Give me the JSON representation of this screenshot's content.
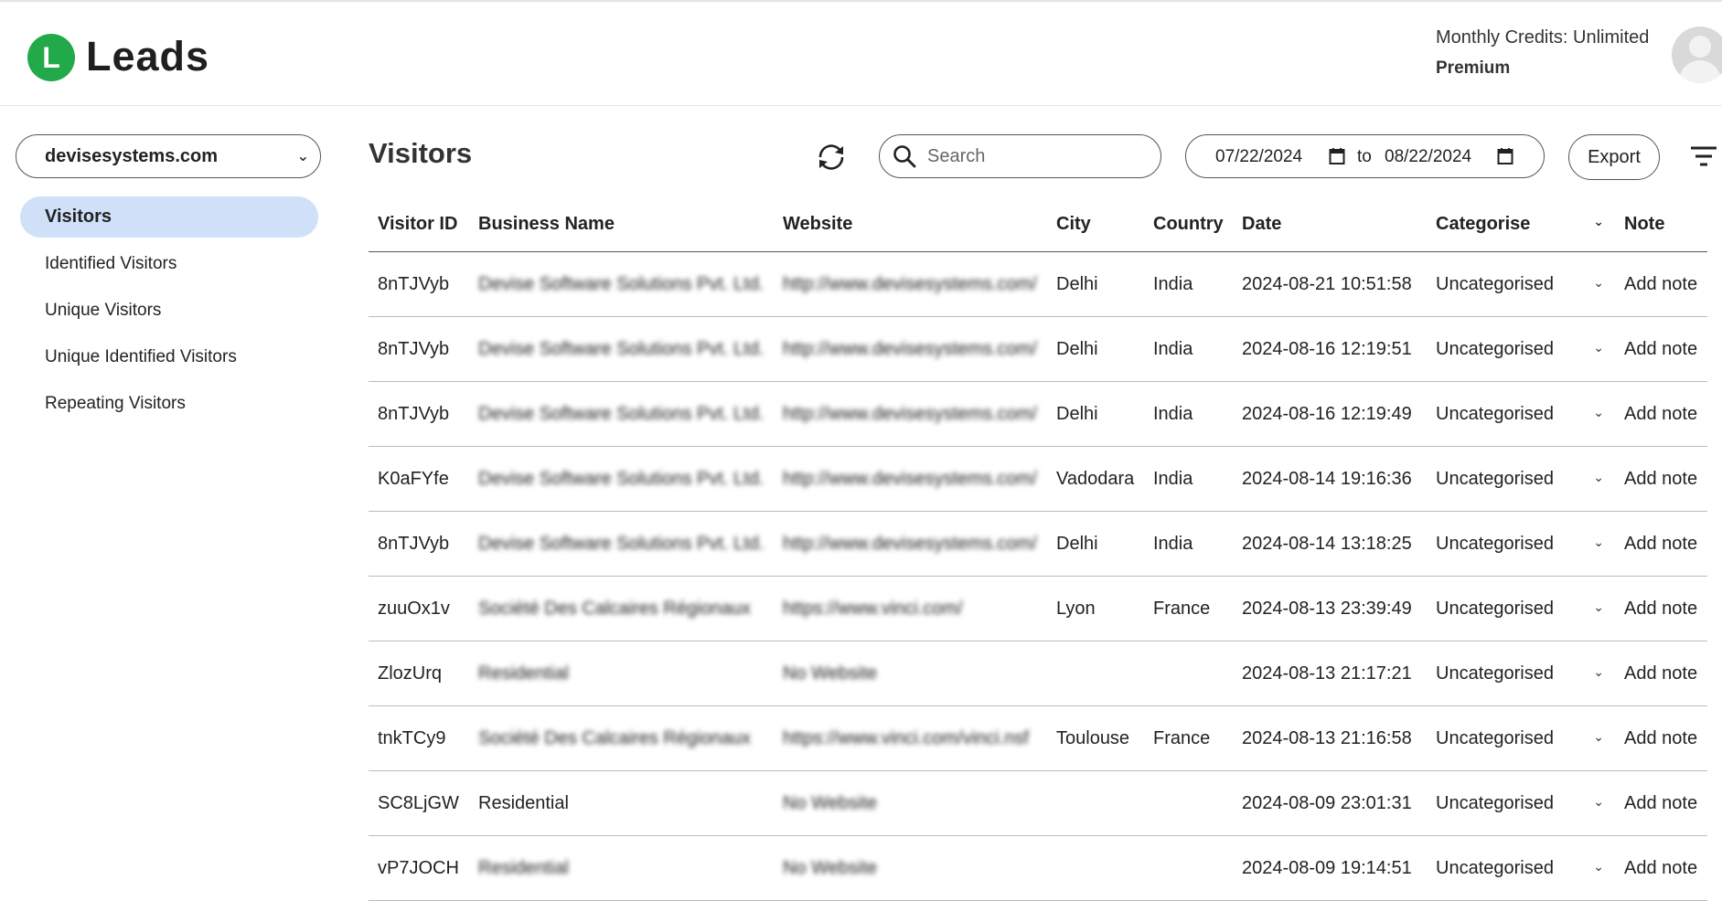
{
  "app": {
    "logo_letter": "L",
    "name": "Leads",
    "brand_color": "#22a94a"
  },
  "account": {
    "credits_text": "Monthly Credits: Unlimited",
    "plan": "Premium"
  },
  "site_selector": {
    "value": "devisesystems.com"
  },
  "sidebar": {
    "items": [
      {
        "label": "Visitors",
        "active": true
      },
      {
        "label": "Identified Visitors",
        "active": false
      },
      {
        "label": "Unique Visitors",
        "active": false
      },
      {
        "label": "Unique Identified Visitors",
        "active": false
      },
      {
        "label": "Repeating Visitors",
        "active": false
      }
    ],
    "active_color": "#cfe0f8"
  },
  "main": {
    "title": "Visitors",
    "search_placeholder": "Search",
    "date_from": "07/22/2024",
    "date_sep": "to",
    "date_to": "08/22/2024",
    "export_label": "Export"
  },
  "table": {
    "headers": [
      "Visitor ID",
      "Business Name",
      "Website",
      "City",
      "Country",
      "Date",
      "Categorise",
      "Note"
    ],
    "rows": [
      {
        "id": "8nTJVyb",
        "business": "Devise Software Solutions Pvt. Ltd.",
        "website": "http://www.devisesystems.com/",
        "city": "Delhi",
        "country": "India",
        "date": "2024-08-21 10:51:58",
        "category": "Uncategorised",
        "note": "Add note"
      },
      {
        "id": "8nTJVyb",
        "business": "Devise Software Solutions Pvt. Ltd.",
        "website": "http://www.devisesystems.com/",
        "city": "Delhi",
        "country": "India",
        "date": "2024-08-16 12:19:51",
        "category": "Uncategorised",
        "note": "Add note"
      },
      {
        "id": "8nTJVyb",
        "business": "Devise Software Solutions Pvt. Ltd.",
        "website": "http://www.devisesystems.com/",
        "city": "Delhi",
        "country": "India",
        "date": "2024-08-16 12:19:49",
        "category": "Uncategorised",
        "note": "Add note"
      },
      {
        "id": "K0aFYfe",
        "business": "Devise Software Solutions Pvt. Ltd.",
        "website": "http://www.devisesystems.com/",
        "city": "Vadodara",
        "country": "India",
        "date": "2024-08-14 19:16:36",
        "category": "Uncategorised",
        "note": "Add note"
      },
      {
        "id": "8nTJVyb",
        "business": "Devise Software Solutions Pvt. Ltd.",
        "website": "http://www.devisesystems.com/",
        "city": "Delhi",
        "country": "India",
        "date": "2024-08-14 13:18:25",
        "category": "Uncategorised",
        "note": "Add note"
      },
      {
        "id": "zuuOx1v",
        "business": "Société Des Calcaires Régionaux",
        "website": "https://www.vinci.com/",
        "city": "Lyon",
        "country": "France",
        "date": "2024-08-13 23:39:49",
        "category": "Uncategorised",
        "note": "Add note"
      },
      {
        "id": "ZlozUrq",
        "business": "Residential",
        "website": "No Website",
        "city": "",
        "country": "",
        "date": "2024-08-13 21:17:21",
        "category": "Uncategorised",
        "note": "Add note"
      },
      {
        "id": "tnkTCy9",
        "business": "Société Des Calcaires Régionaux",
        "website": "https://www.vinci.com/vinci.nsf",
        "city": "Toulouse",
        "country": "France",
        "date": "2024-08-13 21:16:58",
        "category": "Uncategorised",
        "note": "Add note"
      },
      {
        "id": "SC8LjGW",
        "business": "Residential",
        "website": "No Website",
        "city": "",
        "country": "",
        "date": "2024-08-09 23:01:31",
        "category": "Uncategorised",
        "note": "Add note"
      },
      {
        "id": "vP7JOCH",
        "business": "Residential",
        "website": "No Website",
        "city": "",
        "country": "",
        "date": "2024-08-09 19:14:51",
        "category": "Uncategorised",
        "note": "Add note"
      }
    ]
  },
  "icons": {
    "refresh": "refresh-icon",
    "search": "search-icon",
    "calendar": "calendar-icon",
    "filter": "filter-icon",
    "chevron": "chevron-down-icon",
    "avatar": "avatar-icon"
  }
}
